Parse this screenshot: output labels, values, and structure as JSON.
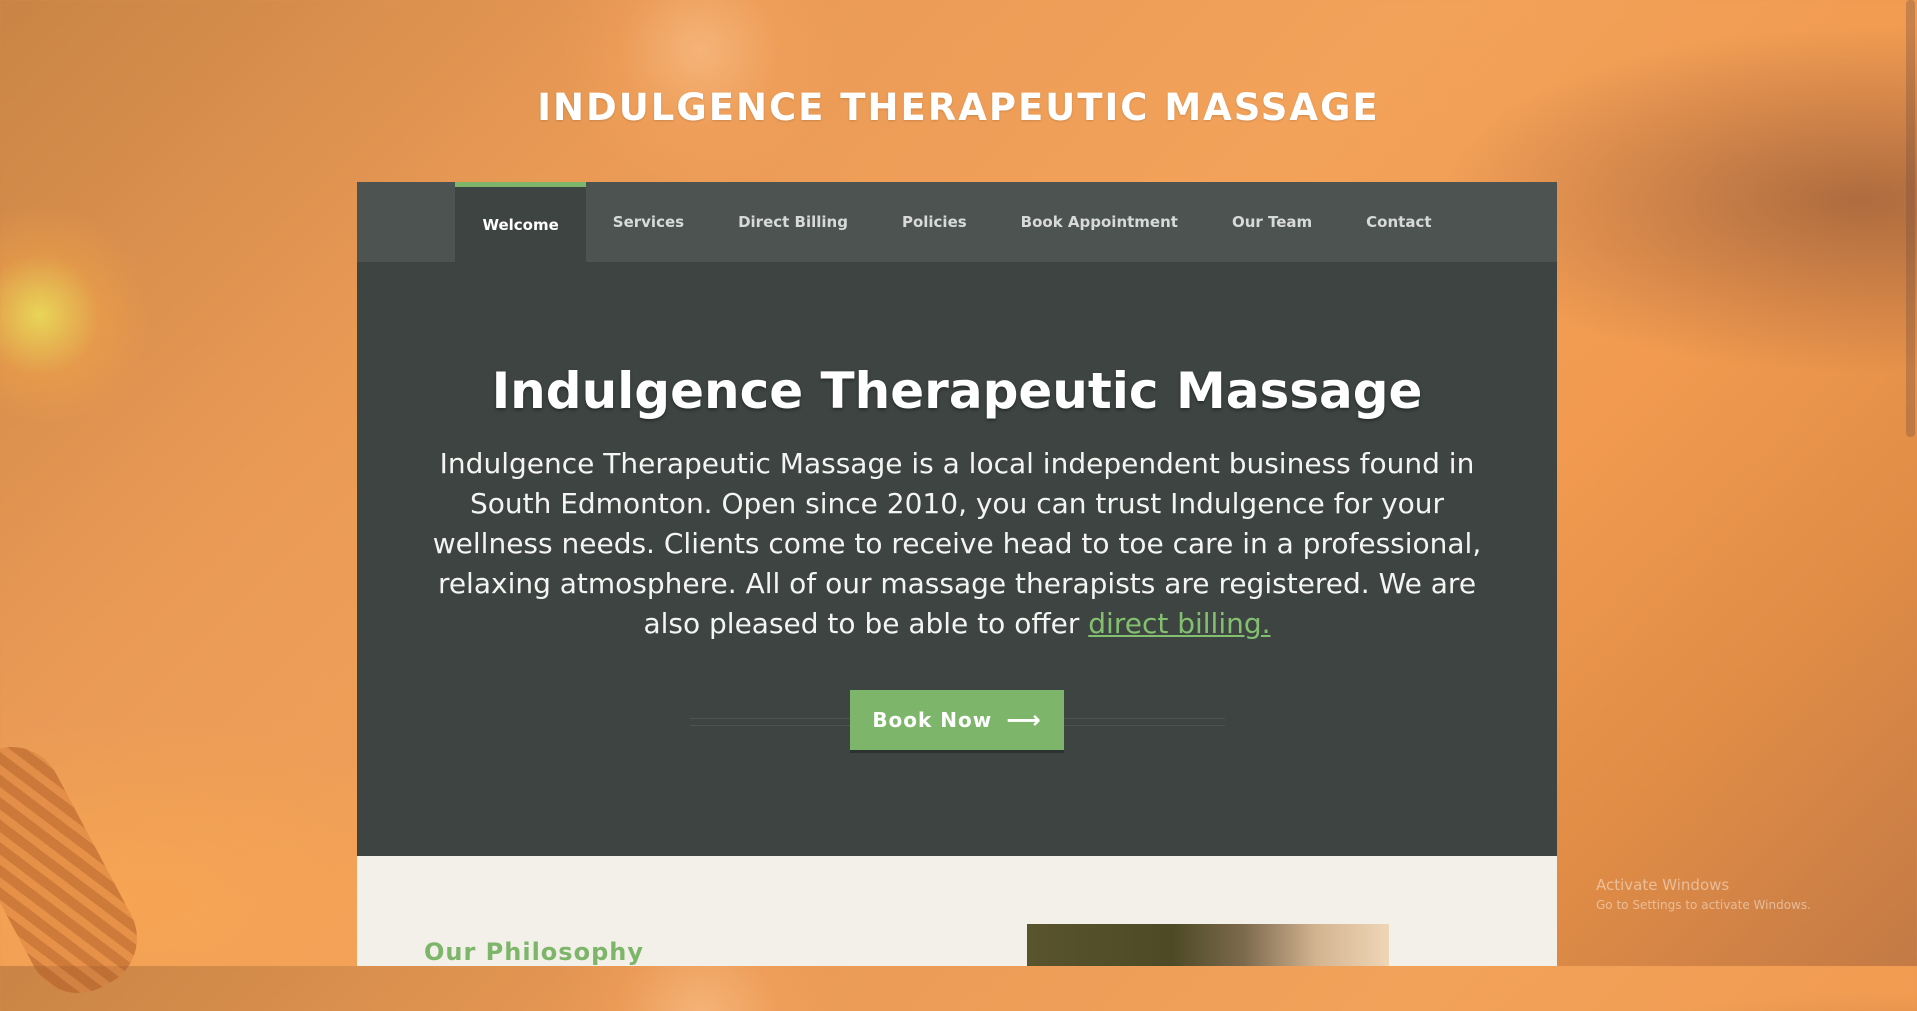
{
  "site": {
    "title": "INDULGENCE THERAPEUTIC MASSAGE"
  },
  "nav": {
    "items": [
      {
        "label": "Welcome",
        "active": true
      },
      {
        "label": "Services"
      },
      {
        "label": "Direct Billing"
      },
      {
        "label": "Policies"
      },
      {
        "label": "Book Appointment"
      },
      {
        "label": "Our Team"
      },
      {
        "label": "Contact"
      }
    ]
  },
  "hero": {
    "heading": "Indulgence Therapeutic Massage",
    "body": "Indulgence Therapeutic Massage is a local independent business found in South Edmonton. Open since 2010, you can trust Indulgence for your wellness needs. Clients come to receive head to toe care in a professional, relaxing atmosphere. All of our massage therapists are registered. We are also pleased to be able to offer ",
    "link_text": "direct billing.",
    "cta_label": "Book Now",
    "cta_icon": "arrow-right-icon"
  },
  "philosophy": {
    "heading": "Our Philosophy"
  },
  "watermark": {
    "line1": "Activate Windows",
    "line2": "Go to Settings to activate Windows."
  },
  "colors": {
    "accent": "#7db66a",
    "panel": "#3d4442",
    "nav": "#4c5351",
    "section_bg": "#f3efe9"
  }
}
